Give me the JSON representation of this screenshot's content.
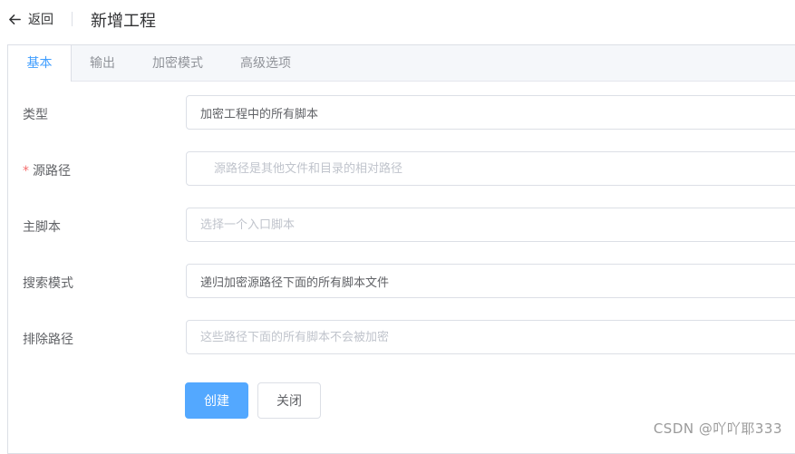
{
  "header": {
    "back_label": "返回",
    "title": "新增工程"
  },
  "tabs": [
    {
      "label": "基本",
      "active": true
    },
    {
      "label": "输出",
      "active": false
    },
    {
      "label": "加密模式",
      "active": false
    },
    {
      "label": "高级选项",
      "active": false
    }
  ],
  "form": {
    "type": {
      "label": "类型",
      "value": "加密工程中的所有脚本"
    },
    "source_path": {
      "required_mark": "*",
      "label": "源路径",
      "placeholder": "源路径是其他文件和目录的相对路径"
    },
    "main_script": {
      "label": "主脚本",
      "placeholder": "选择一个入口脚本"
    },
    "search_mode": {
      "label": "搜索模式",
      "value": "递归加密源路径下面的所有脚本文件"
    },
    "exclude_path": {
      "label": "排除路径",
      "placeholder": "这些路径下面的所有脚本不会被加密"
    }
  },
  "actions": {
    "create_label": "创建",
    "close_label": "关闭"
  },
  "watermark": "CSDN @吖吖耶333",
  "colors": {
    "accent": "#409eff",
    "primary_button": "#53a8ff",
    "required": "#f56c6c"
  }
}
